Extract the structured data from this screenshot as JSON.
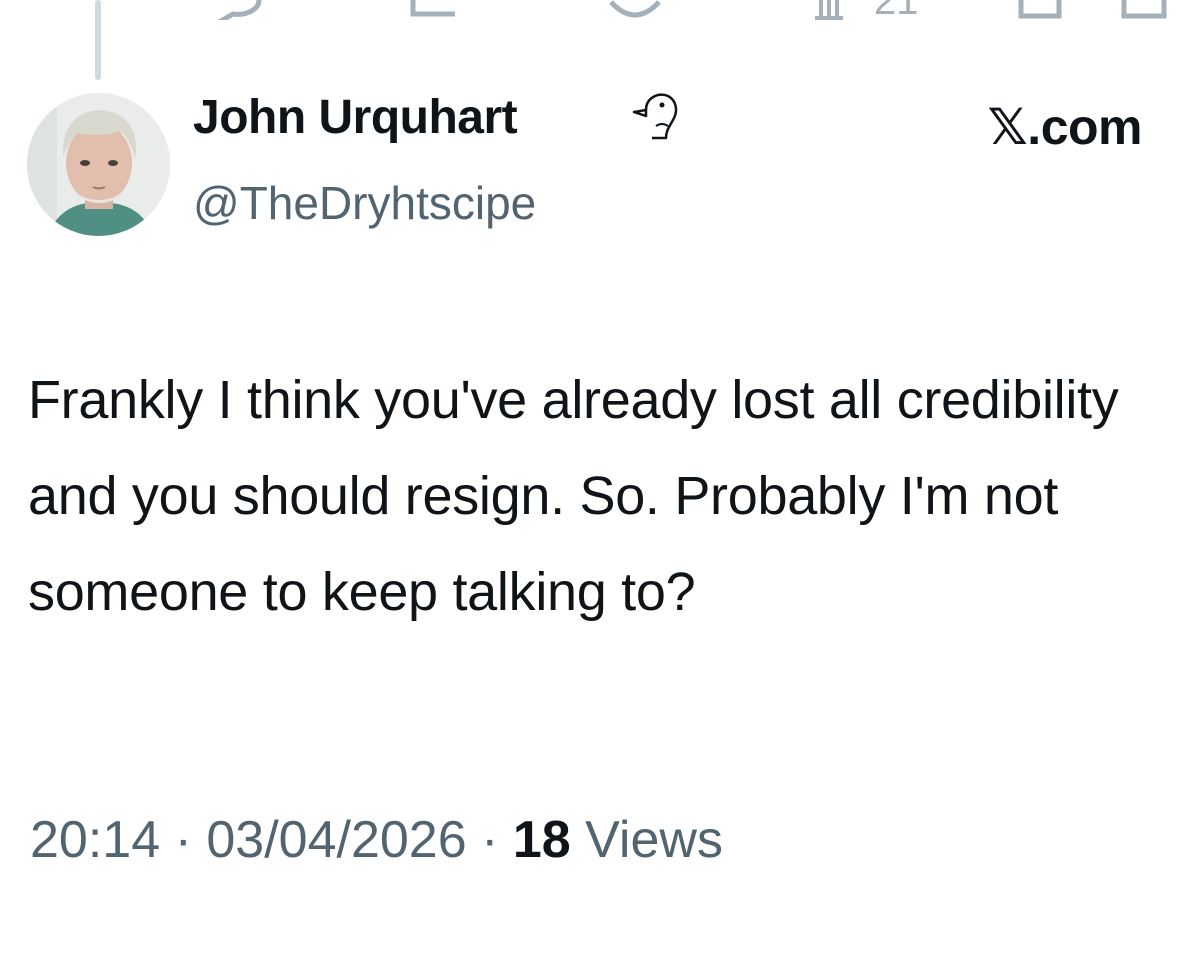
{
  "tweet": {
    "author": {
      "name": "John Urquhart",
      "handle": "@TheDryhtscipe",
      "avatar_icon": "user-avatar-photo",
      "badge_icon": "bird-head-icon"
    },
    "brand": "𝕏.com",
    "text": "Frankly I think you've already lost all credibility and you should resign. So. Probably I'm not someone to keep talking to?",
    "time": "20:14",
    "date": "03/04/2026",
    "separator": "·",
    "views_count": "18",
    "views_label": "Views"
  },
  "previous_tweet": {
    "actions": [
      "reply-icon",
      "repost-icon",
      "like-icon",
      "views-icon",
      "bookmark-icon",
      "share-icon"
    ],
    "views_count_partial": "21"
  },
  "colors": {
    "text": "#0f1419",
    "secondary": "#536471",
    "thread_line": "#cfd9de"
  }
}
